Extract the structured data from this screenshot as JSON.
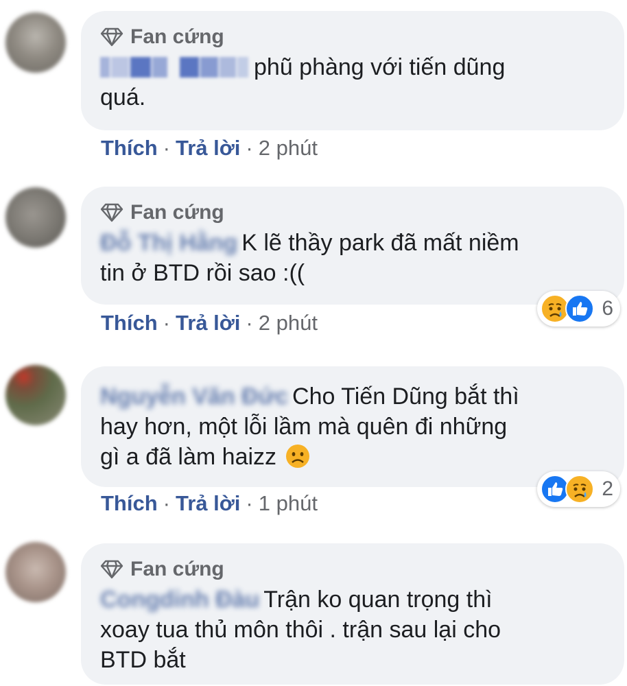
{
  "comments": [
    {
      "badge": "Fan cứng",
      "author": "Ngọc Anh",
      "text_line1": "phũ phàng với tiến dũng",
      "text_line2": "quá.",
      "like": "Thích",
      "reply": "Trả lời",
      "time": "2 phút"
    },
    {
      "badge": "Fan cứng",
      "author": "Đỗ Thị Hằng",
      "text_line1": "K lẽ thầy park đã mất niềm",
      "text_line2": "tin ở BTD rồi sao :((",
      "like": "Thích",
      "reply": "Trả lời",
      "time": "2 phút",
      "reactions": [
        "sad-icon",
        "like-icon"
      ],
      "reaction_count": "6"
    },
    {
      "author": "Nguyễn Văn Đức",
      "text_line1": "Cho Tiến Dũng bắt thì",
      "text_line2": "hay hơn, một lỗi lầm mà quên đi những",
      "text_line3": "gì a đã làm haizz",
      "like": "Thích",
      "reply": "Trả lời",
      "time": "1 phút",
      "reactions": [
        "like-icon",
        "sad-icon"
      ],
      "reaction_count": "2"
    },
    {
      "badge": "Fan cứng",
      "author": "Congdinh Đàu",
      "text_line1": "Trận ko quan trọng thì",
      "text_line2": "xoay tua thủ môn thôi . trận sau lại cho",
      "text_line3": "BTD bắt"
    }
  ],
  "colors": {
    "bubble": "#f0f2f5",
    "link": "#385898",
    "meta": "#65676b",
    "like_blue": "#1877f2",
    "sad_yellow": "#f7b125"
  }
}
